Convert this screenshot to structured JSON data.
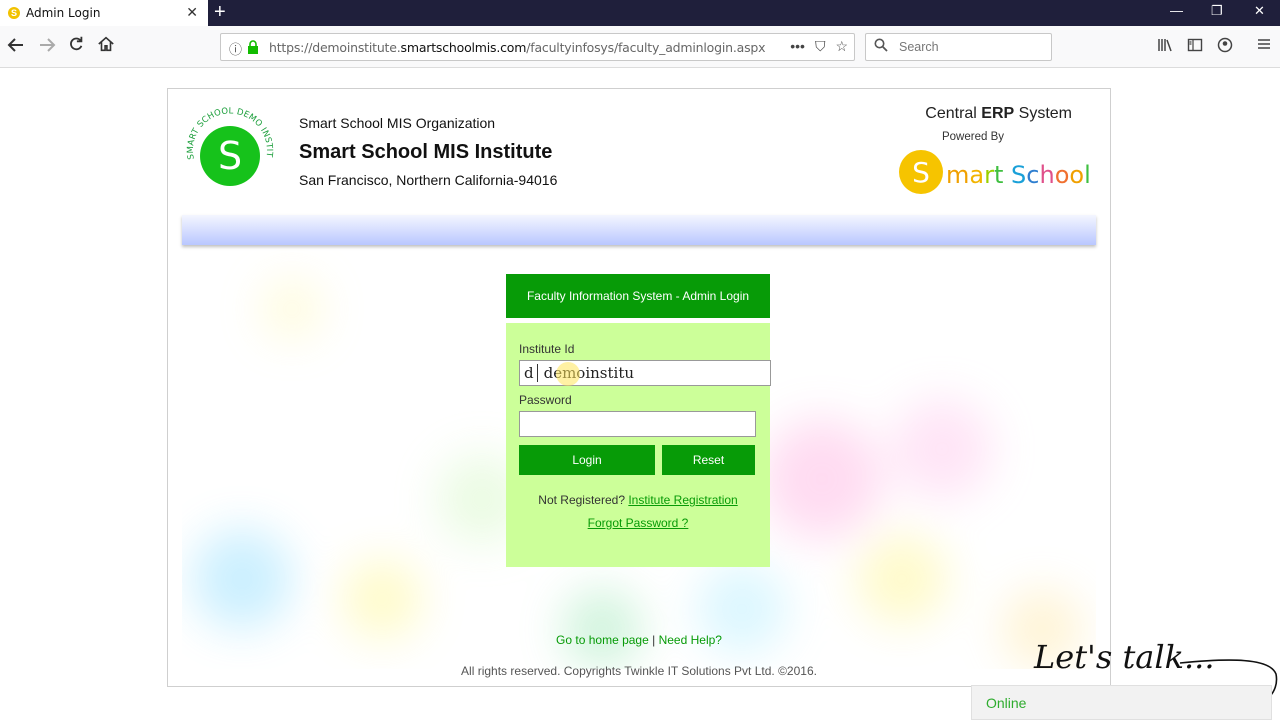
{
  "browser": {
    "tab_title": "Admin Login",
    "tab_favicon": "S",
    "url_prefix": "https://demoinstitute.",
    "url_domain": "smartschoolmis.com",
    "url_path": "/facultyinfosys/faculty_adminlogin.aspx",
    "search_placeholder": "Search"
  },
  "header": {
    "org_name": "Smart School MIS Organization",
    "institute_name": "Smart School MIS Institute",
    "address": "San Francisco, Northern California-94016",
    "erp_prefix": "Central ",
    "erp_bold": "ERP",
    "erp_suffix": " System",
    "powered_by": "Powered By",
    "seal_text": "SMART SCHOOL DEMO INSTITUTE ENGINEERING",
    "seal_letter": "S",
    "brand_logo_text": "Smart School"
  },
  "login": {
    "title": "Faculty Information System - Admin Login",
    "institute_id_label": "Institute Id",
    "institute_id_autocomplete": "d",
    "institute_id_value": "demoinstitu",
    "password_label": "Password",
    "login_button": "Login",
    "reset_button": "Reset",
    "not_registered": "Not Registered? ",
    "registration_link": "Institute Registration",
    "forgot_link": "Forgot Password ?"
  },
  "footer": {
    "home_link": "Go to home page",
    "separator": " | ",
    "help_link": "Need Help?",
    "copyright": "All rights reserved. Copyrights Twinkle IT Solutions Pvt Ltd. ©2016."
  },
  "chat": {
    "tagline": "Let's talk...",
    "status": "Online"
  },
  "colors": {
    "primary_green": "#079b07",
    "login_body": "#ccff99",
    "tabbar": "#1f1f3b"
  }
}
